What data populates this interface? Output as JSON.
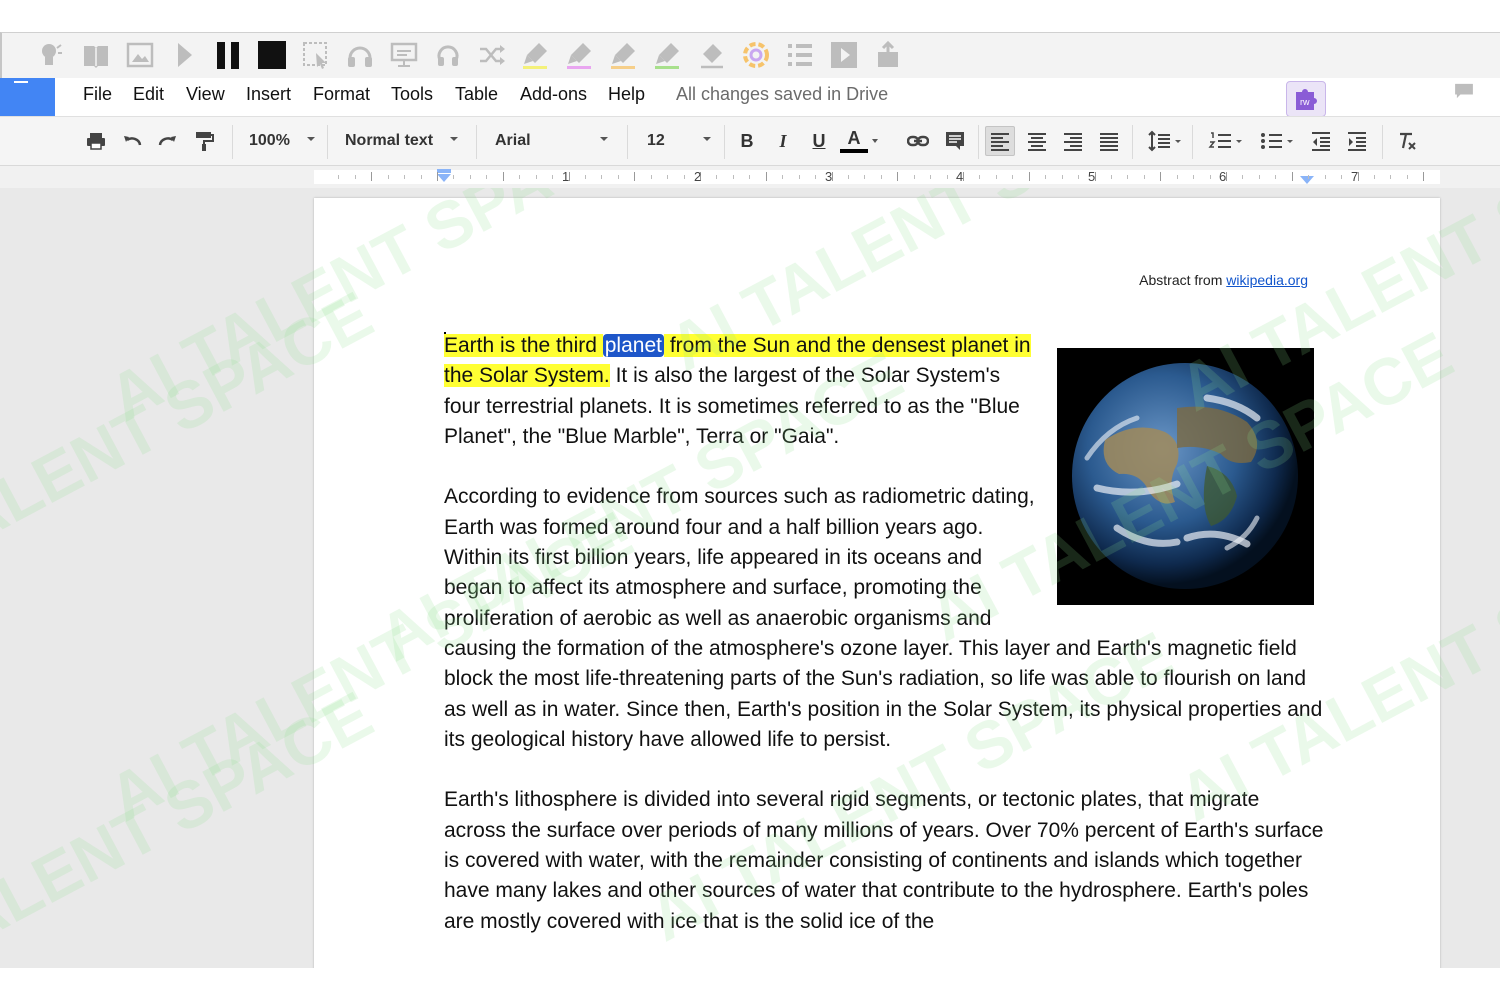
{
  "extension_toolbar": {
    "icons": [
      "head-icon",
      "book-icon",
      "image-icon",
      "play-icon",
      "pause-icon",
      "stop-icon",
      "select-icon",
      "headphones-icon",
      "screen-icon",
      "audio-icon",
      "shuffle-icon",
      "highlighter-yellow-icon",
      "highlighter-pink-icon",
      "highlighter-orange-icon",
      "highlighter-green-icon",
      "eraser-icon",
      "color-wheel-icon",
      "list-icon",
      "video-icon",
      "share-icon"
    ]
  },
  "menu": {
    "items": [
      "File",
      "Edit",
      "View",
      "Insert",
      "Format",
      "Tools",
      "Table",
      "Add-ons",
      "Help"
    ],
    "status": "All changes saved in Drive"
  },
  "addon_badge": {
    "label": "rw"
  },
  "toolbar": {
    "zoom": "100%",
    "style": "Normal text",
    "font": "Arial",
    "size": "12",
    "bold": "B",
    "italic": "I",
    "underline": "U",
    "text_color": "A"
  },
  "ruler": {
    "labels": [
      "1",
      "2",
      "3",
      "4",
      "5",
      "6",
      "7"
    ]
  },
  "document": {
    "abstract_prefix": "Abstract from",
    "abstract_link": "wikipedia.org",
    "p1": {
      "highlight_a": "Earth is the third",
      "selected": "planet",
      "highlight_b": "from the Sun and the densest planet in the Solar System.",
      "rest": "It is also the largest of the Solar System's four terrestrial planets. It is sometimes referred to as the \"Blue Planet\", the \"Blue Marble\", Terra or \"Gaia\"."
    },
    "p2": "According to evidence from sources such as radiometric dating, Earth was formed around four and a half billion years ago. Within its first billion years, life appeared in its oceans and began to affect its atmosphere and surface, promoting the proliferation of aerobic as well as anaerobic organisms and causing the formation of the atmosphere's ozone layer. This layer and Earth's magnetic field block the most life-threatening parts of the Sun's radiation, so life was able to flourish on land as well as in water. Since then, Earth's position in the Solar System, its physical properties and its geological history have allowed life to persist.",
    "p3": "Earth's lithosphere is divided into several rigid segments, or tectonic plates, that migrate across the surface over periods of many millions of years. Over 70% percent of Earth's surface is covered with water, with the remainder consisting of continents and islands which together have many lakes and other sources of water that contribute to the hydrosphere. Earth's poles are mostly covered with ice that is the solid ice of the"
  },
  "watermark": {
    "text": "AI TALENT SPACE"
  },
  "colors": {
    "accent": "#4285f4",
    "highlight": "#ffff33",
    "selection": "#1e56c9",
    "link": "#1155cc"
  }
}
